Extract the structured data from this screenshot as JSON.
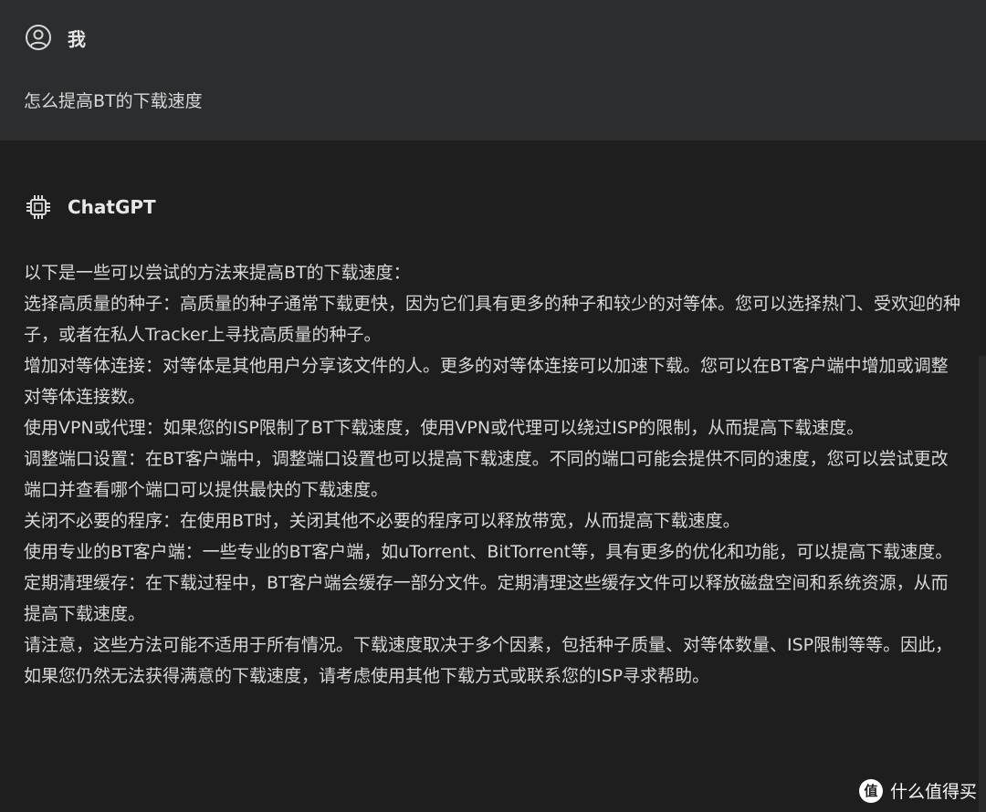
{
  "user": {
    "name": "我",
    "message": "怎么提高BT的下载速度",
    "icon": "user-circle-icon"
  },
  "assistant": {
    "name": "ChatGPT",
    "icon": "chip-icon",
    "paragraphs": [
      "以下是一些可以尝试的方法来提高BT的下载速度：",
      "选择高质量的种子：高质量的种子通常下载更快，因为它们具有更多的种子和较少的对等体。您可以选择热门、受欢迎的种子，或者在私人Tracker上寻找高质量的种子。",
      "增加对等体连接：对等体是其他用户分享该文件的人。更多的对等体连接可以加速下载。您可以在BT客户端中增加或调整对等体连接数。",
      "使用VPN或代理：如果您的ISP限制了BT下载速度，使用VPN或代理可以绕过ISP的限制，从而提高下载速度。",
      "调整端口设置：在BT客户端中，调整端口设置也可以提高下载速度。不同的端口可能会提供不同的速度，您可以尝试更改端口并查看哪个端口可以提供最快的下载速度。",
      "关闭不必要的程序：在使用BT时，关闭其他不必要的程序可以释放带宽，从而提高下载速度。",
      "使用专业的BT客户端：一些专业的BT客户端，如uTorrent、BitTorrent等，具有更多的优化和功能，可以提高下载速度。",
      "定期清理缓存：在下载过程中，BT客户端会缓存一部分文件。定期清理这些缓存文件可以释放磁盘空间和系统资源，从而提高下载速度。",
      "请注意，这些方法可能不适用于所有情况。下载速度取决于多个因素，包括种子质量、对等体数量、ISP限制等等。因此，如果您仍然无法获得满意的下载速度，请考虑使用其他下载方式或联系您的ISP寻求帮助。"
    ]
  },
  "watermark": {
    "badge": "值",
    "text": "什么值得买"
  },
  "colors": {
    "background": "#1e1e1e",
    "user_block": "#2b2d2e",
    "text": "#d8d8d8"
  }
}
